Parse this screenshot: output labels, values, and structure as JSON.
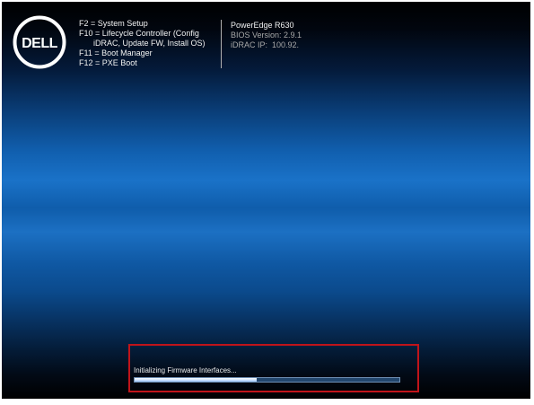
{
  "logo": {
    "text": "DELL"
  },
  "boot_menu": [
    {
      "key": "F2",
      "sep": " = ",
      "label": "System Setup"
    },
    {
      "key": "F10",
      "sep": " = ",
      "label": "Lifecycle Controller (Config"
    },
    {
      "key": "",
      "sep": "",
      "label": "iDRAC, Update FW, Install OS)"
    },
    {
      "key": "F11",
      "sep": " = ",
      "label": "Boot Manager"
    },
    {
      "key": "F12",
      "sep": " = ",
      "label": "PXE Boot"
    }
  ],
  "system_info": {
    "model": "PowerEdge R630",
    "bios_version": "BIOS Version: 2.9.1",
    "idrac_ip": "iDRAC IP:  100.92."
  },
  "status": {
    "text": "Initializing Firmware Interfaces...",
    "progress": 0.46
  },
  "colors": {
    "highlight_border": "#c0141a",
    "background_blue": "#1a72c8"
  }
}
